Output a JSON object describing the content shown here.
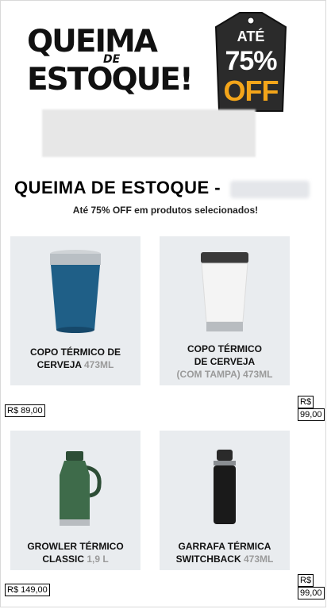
{
  "hero": {
    "line1": "QUEIMA",
    "connector": "DE",
    "line2": "ESTOQUE!",
    "tag": {
      "prefix": "ATÉ",
      "percent": "75%",
      "off": "OFF"
    }
  },
  "section": {
    "title": "QUEIMA DE ESTOQUE -",
    "subtitle": "Até 75% OFF em produtos selecionados!"
  },
  "products": [
    {
      "name_line1": "COPO TÉRMICO DE",
      "name_line2": "CERVEJA",
      "size": "473ML",
      "price": "R$ 89,00",
      "color": "#1f5f87"
    },
    {
      "name_line1": "COPO TÉRMICO",
      "name_line2": "DE CERVEJA",
      "name_line3": "(COM TAMPA)",
      "size": "473ML",
      "price_currency": "R$",
      "price_value": "99,00",
      "color": "#f4f4f4"
    },
    {
      "name_line1": "GROWLER TÉRMICO",
      "name_line2": "CLASSIC",
      "size": "1,9 L",
      "price": "R$ 149,00",
      "color": "#3e6b4a"
    },
    {
      "name_line1": "GARRAFA TÉRMICA",
      "name_line2": "SWITCHBACK",
      "size": "473ML",
      "price_currency": "R$",
      "price_value": "99,00",
      "color": "#1a1a1a"
    }
  ]
}
